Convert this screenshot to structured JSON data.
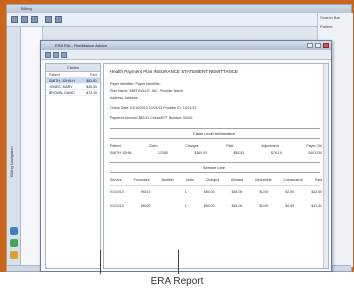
{
  "caption": "ERA Report",
  "app": {
    "title": "Billing",
    "nav_label": "Billing Navigation",
    "right_panel": [
      "Search Bar",
      "Patient"
    ]
  },
  "window": {
    "title": "ERA File - Remittance Advice"
  },
  "claims_list": {
    "header": "Claims",
    "columns": [
      "Patient",
      "Paid"
    ],
    "rows": [
      {
        "name": "SMITH, JOHN H",
        "amount": "$83.81",
        "selected": true
      },
      {
        "name": "JONES, MARY",
        "amount": "$45.00",
        "selected": false
      },
      {
        "name": "BROWN, DAVID",
        "amount": "$72.15",
        "selected": false
      }
    ]
  },
  "report": {
    "title": "Health Payment Plan   INSURANCE   STATEMENT  REMITTANCE",
    "header_lines": [
      "Payer Identifier:                    Payee Identifier:",
      "Plan Name:                           SMITHVILLE, INC.    Provider Name",
      "Address:                             Address:",
      "Check Date:  01/10/2013   10/21/13   Provider ID:       10/21/13",
      "Payment Amount:   $83.81   Check/EFT Number:   00041"
    ],
    "section_1": "Claim Level Information",
    "claim_columns": [
      "Patient",
      "Claim",
      "Charges",
      "Paid",
      "Adjustment",
      "Payer Ctrl"
    ],
    "claim_values": [
      "SMITH JOHN",
      "12345",
      "$160.00",
      "$83.81",
      "$76.19",
      "0001234"
    ],
    "section_2": "Service Line",
    "service_columns": [
      "Service",
      "Procedure",
      "Modifier",
      "Units",
      "Charged",
      "Allowed",
      "Deductible",
      "Coinsurance",
      "Paid"
    ],
    "service_rows": [
      [
        "01/10/13",
        "99213",
        "",
        "1",
        "$80.00",
        "$45.00",
        "$0.00",
        "$2.50",
        "$42.50"
      ],
      [
        "01/10/13",
        "85025",
        "",
        "1",
        "$80.00",
        "$44.00",
        "$0.00",
        "$2.69",
        "$41.31"
      ]
    ]
  }
}
